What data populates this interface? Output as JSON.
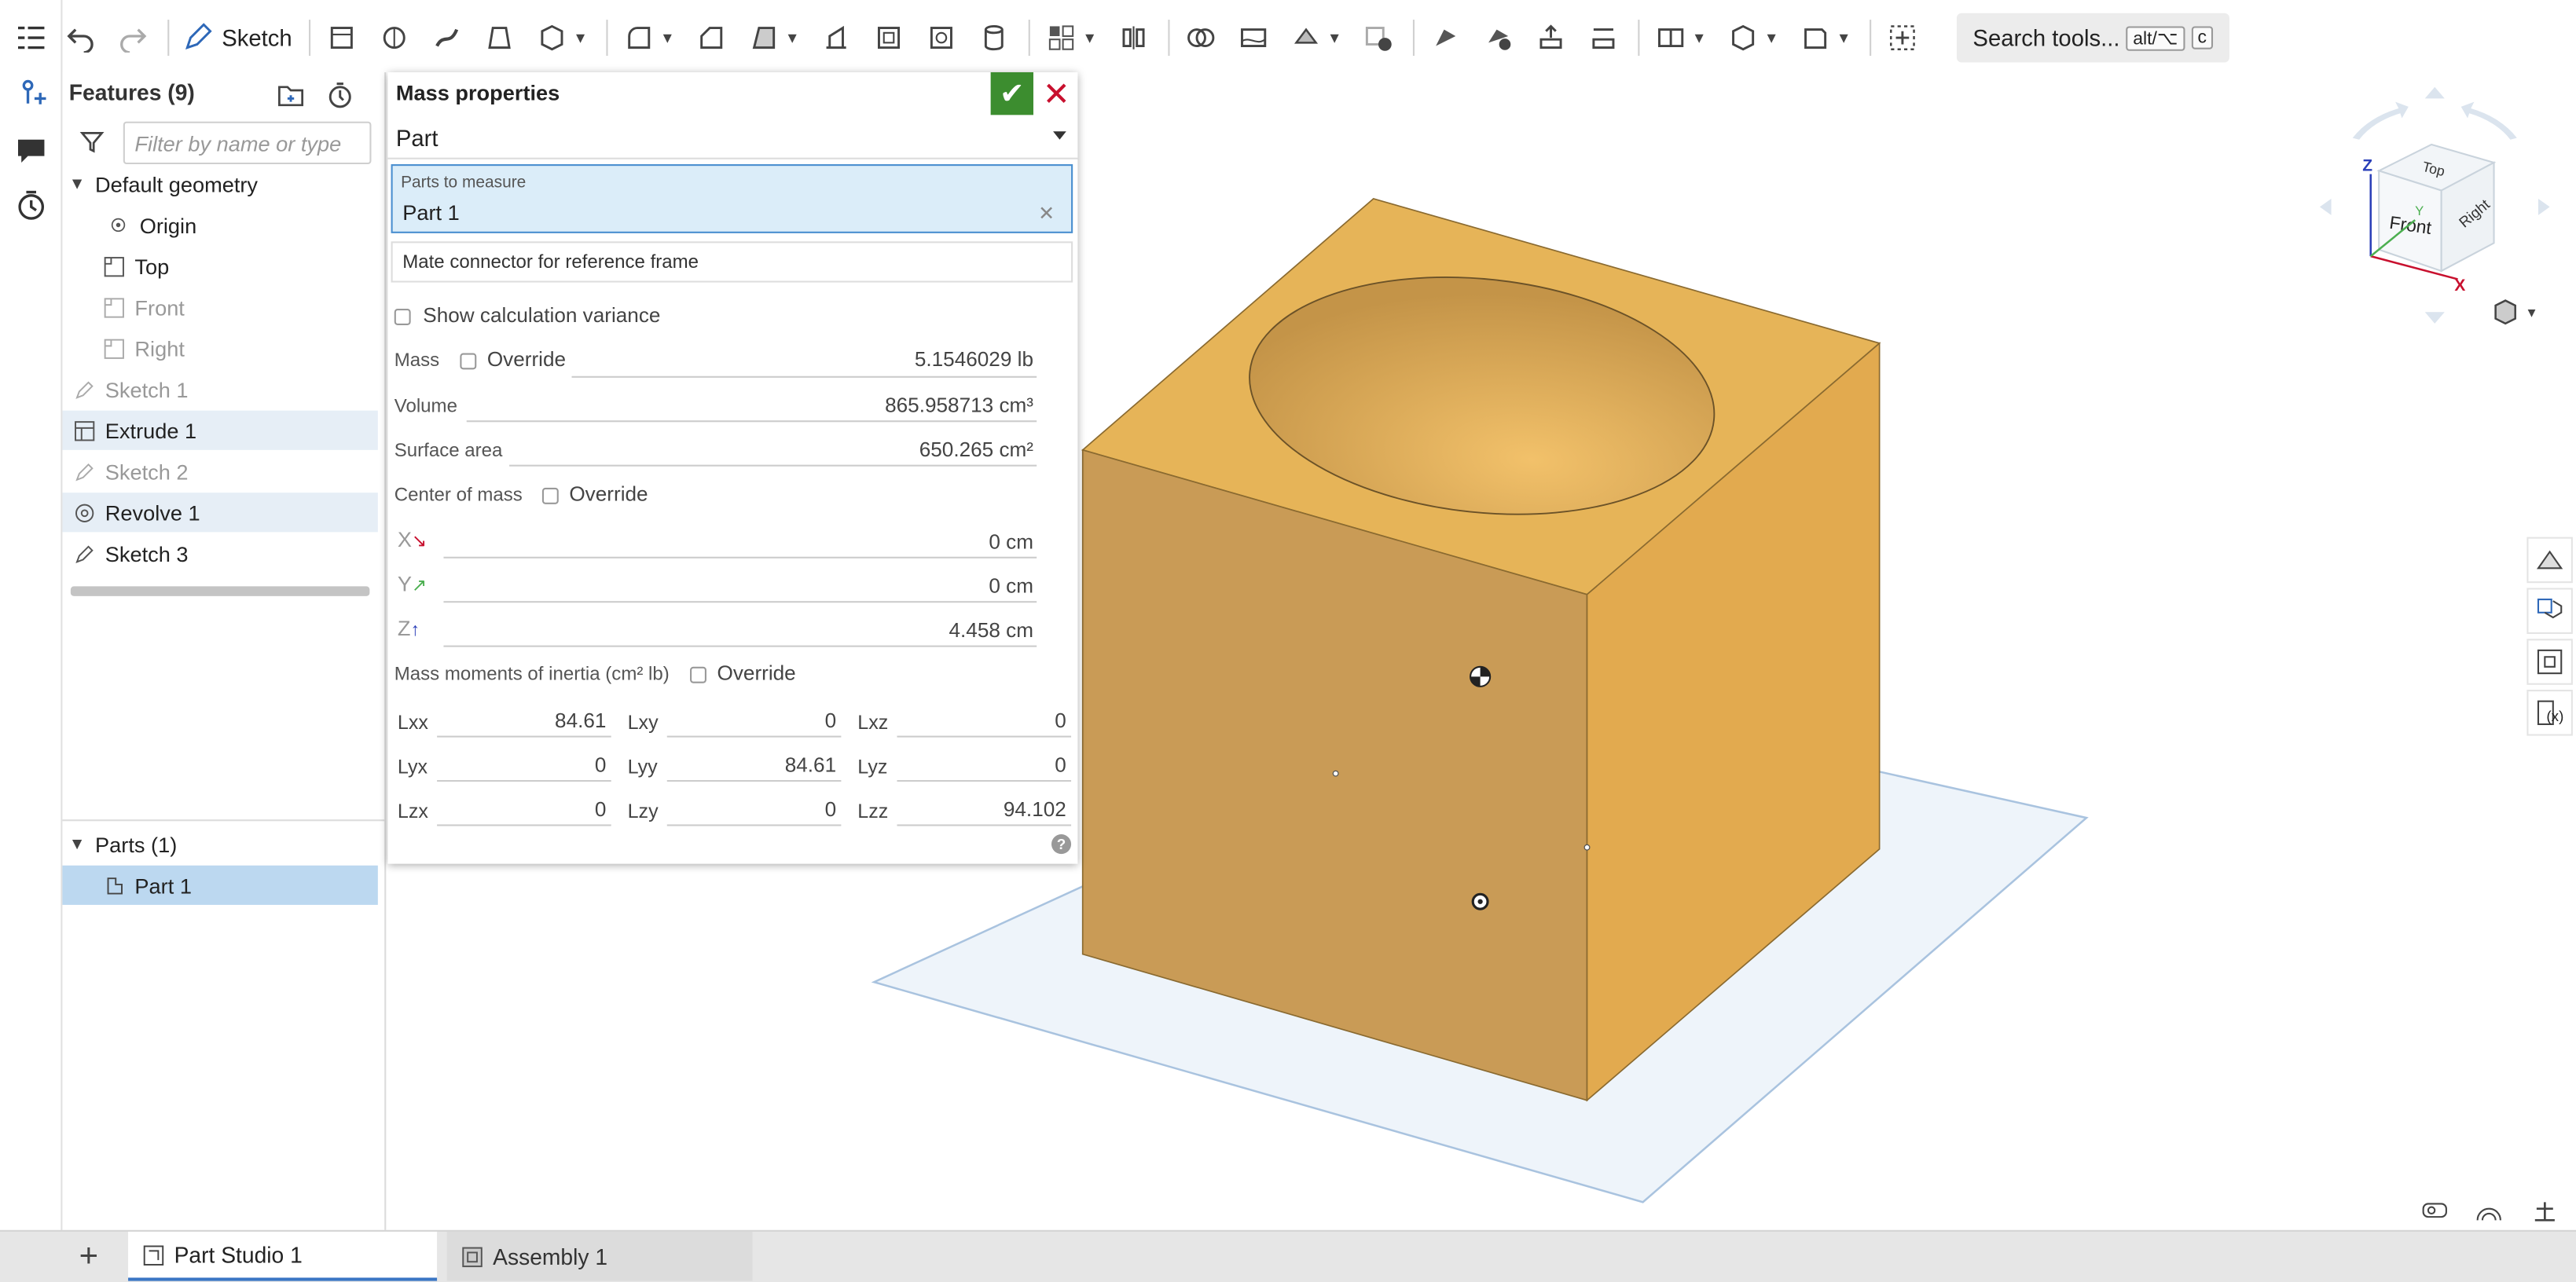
{
  "toolbar": {
    "sketch_label": "Sketch",
    "search_label": "Search tools...",
    "search_key1": "alt/⌥",
    "search_key2": "c"
  },
  "features": {
    "title": "Features (9)",
    "filter_placeholder": "Filter by name or type",
    "items": [
      {
        "label": "Default geometry"
      },
      {
        "label": "Origin"
      },
      {
        "label": "Top"
      },
      {
        "label": "Front"
      },
      {
        "label": "Right"
      },
      {
        "label": "Sketch 1"
      },
      {
        "label": "Extrude 1"
      },
      {
        "label": "Sketch 2"
      },
      {
        "label": "Revolve 1"
      },
      {
        "label": "Sketch 3"
      }
    ],
    "parts_title": "Parts (1)",
    "part_item": "Part 1"
  },
  "mass_properties": {
    "title": "Mass properties",
    "mode": "Part",
    "parts_label": "Parts to measure",
    "parts_value": "Part 1",
    "mate_connector": "Mate connector for reference frame",
    "show_variance": "Show calculation variance",
    "mass_label": "Mass",
    "override_label": "Override",
    "mass_value": "5.1546029 lb",
    "volume_label": "Volume",
    "volume_value": "865.958713 cm³",
    "surface_label": "Surface area",
    "surface_value": "650.265 cm²",
    "com_label": "Center of mass",
    "x_axis": "X",
    "y_axis": "Y",
    "z_axis": "Z",
    "com_x": "0 cm",
    "com_y": "0 cm",
    "com_z": "4.458 cm",
    "moi_label": "Mass moments of inertia (cm² lb)",
    "moi": {
      "lxx_label": "Lxx",
      "lxx": "84.61",
      "lxy_label": "Lxy",
      "lxy": "0",
      "lxz_label": "Lxz",
      "lxz": "0",
      "lyx_label": "Lyx",
      "lyx": "0",
      "lyy_label": "Lyy",
      "lyy": "84.61",
      "lyz_label": "Lyz",
      "lyz": "0",
      "lzx_label": "Lzx",
      "lzx": "0",
      "lzy_label": "Lzy",
      "lzy": "0",
      "lzz_label": "Lzz",
      "lzz": "94.102"
    },
    "help": "?"
  },
  "viewcube": {
    "top": "Top",
    "front": "Front",
    "right": "Right",
    "axis_x": "X",
    "axis_y": "Y",
    "axis_z": "Z"
  },
  "tabs": {
    "part_studio": "Part Studio 1",
    "assembly": "Assembly 1"
  },
  "colors": {
    "accent": "#3a76c4",
    "confirm": "#3c8d2f",
    "cancel": "#c8102e",
    "part_top": "#e6b458",
    "part_front": "#c99b56",
    "part_right": "#e2aa4f"
  }
}
